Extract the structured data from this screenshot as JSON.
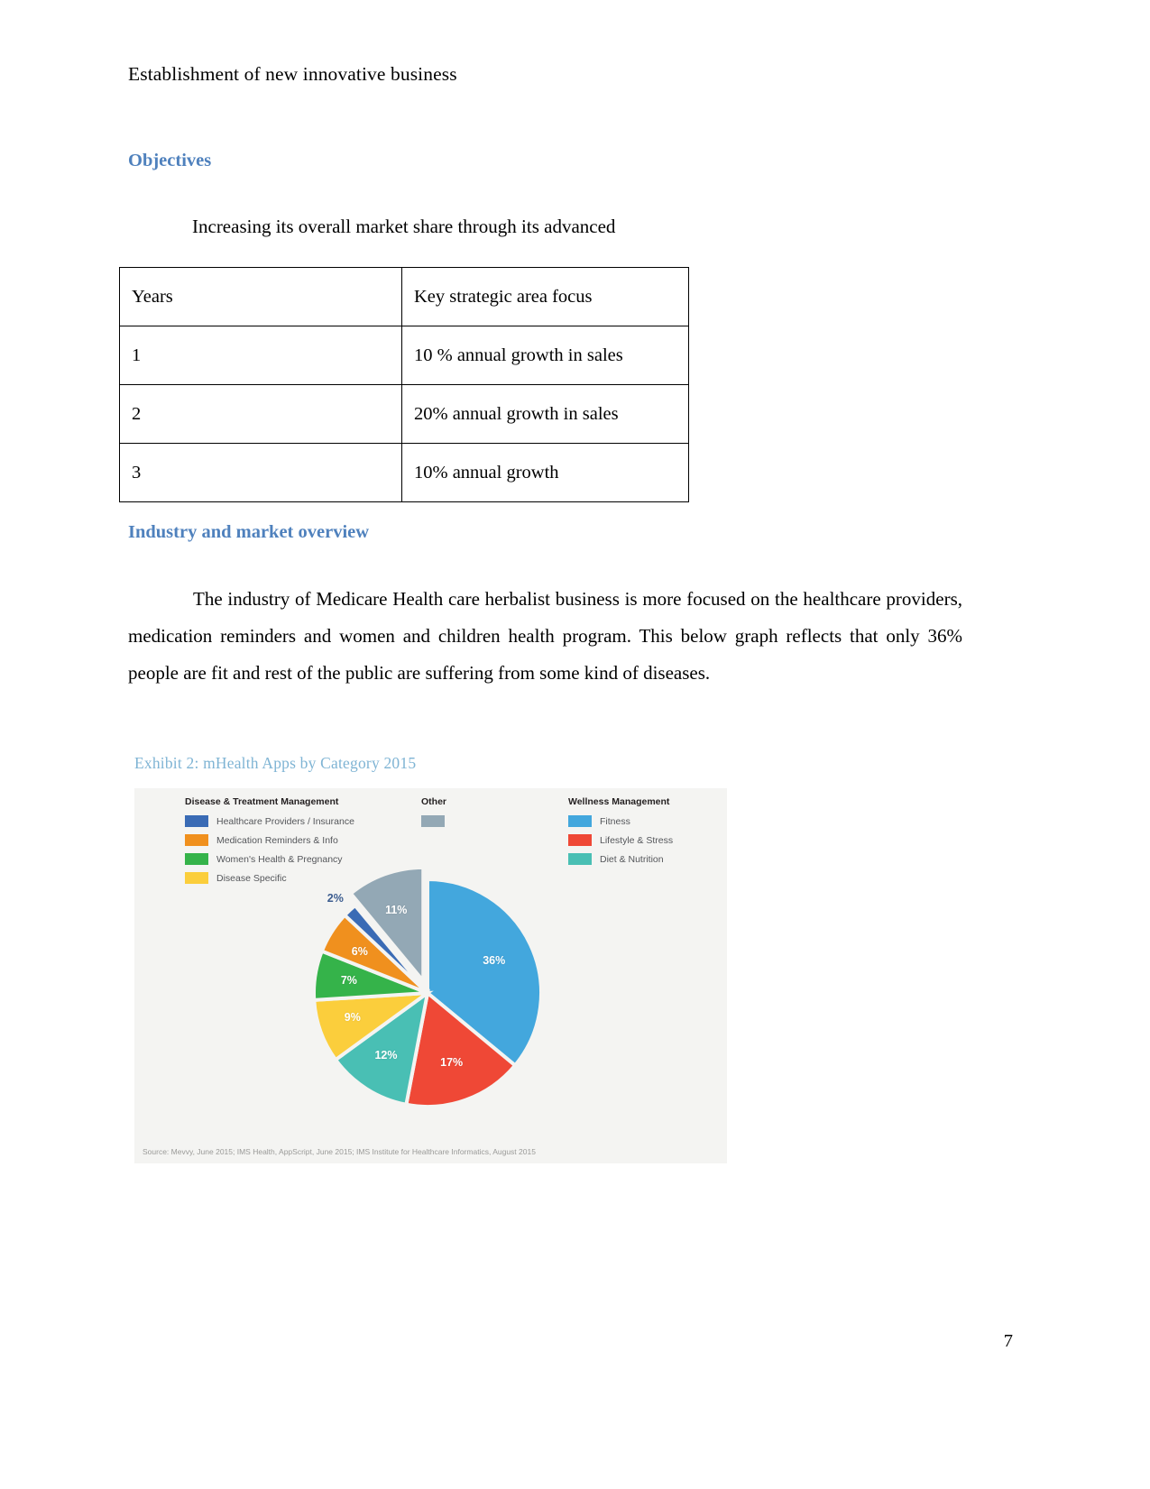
{
  "document": {
    "header": "Establishment of new innovative business",
    "page_number": "7",
    "sections": {
      "objectives_heading": "Objectives",
      "objectives_intro": "Increasing its overall market share through its advanced",
      "industry_heading": "Industry and market overview",
      "industry_para": "The industry of Medicare Health care herbalist business is more focused on the healthcare providers, medication reminders and women and children health program. This below graph reflects that only 36% people are fit and rest of the public are suffering from some kind of diseases."
    },
    "objectives_table": {
      "headers": [
        "Years",
        "Key strategic area focus"
      ],
      "rows": [
        [
          "1",
          "10 % annual growth in sales"
        ],
        [
          "2",
          "20% annual growth in sales"
        ],
        [
          "3",
          "10% annual growth"
        ]
      ]
    }
  },
  "colors": {
    "heading_blue": "#4f81bd",
    "exhibit_title_blue": "#7fb4d4",
    "chart_background": "#f4f4f2"
  },
  "chart_data": {
    "type": "pie",
    "title": "Exhibit 2: mHealth Apps by Category 2015",
    "source": "Source: Mevvy, June 2015; IMS Health, AppScript, June 2015; IMS Institute for Healthcare Informatics, August 2015",
    "legend_position": "top",
    "legend_groups": [
      {
        "heading": "Disease & Treatment Management",
        "items": [
          {
            "label": "Healthcare Providers / Insurance",
            "color": "#3a6bb5"
          },
          {
            "label": "Medication Reminders & Info",
            "color": "#f0901e"
          },
          {
            "label": "Women's Health & Pregnancy",
            "color": "#35b34a"
          },
          {
            "label": "Disease Specific",
            "color": "#fbce3c"
          }
        ]
      },
      {
        "heading": "Other",
        "items": [
          {
            "label": "",
            "color": "#93a8b5"
          }
        ]
      },
      {
        "heading": "Wellness Management",
        "items": [
          {
            "label": "Fitness",
            "color": "#43a7dd"
          },
          {
            "label": "Lifestyle & Stress",
            "color": "#ef4836"
          },
          {
            "label": "Diet & Nutrition",
            "color": "#49bfb4"
          }
        ]
      }
    ],
    "categories": [
      "Fitness",
      "Lifestyle & Stress",
      "Diet & Nutrition",
      "Disease Specific",
      "Women's Health & Pregnancy",
      "Medication Reminders & Info",
      "Healthcare Providers / Insurance",
      "Other"
    ],
    "values": [
      36,
      17,
      12,
      9,
      7,
      6,
      2,
      11
    ],
    "value_labels": [
      "36%",
      "17%",
      "12%",
      "9%",
      "7%",
      "6%",
      "2%",
      "11%"
    ],
    "slice_colors": [
      "#43a7dd",
      "#ef4836",
      "#49bfb4",
      "#fbce3c",
      "#35b34a",
      "#f0901e",
      "#3a6bb5",
      "#93a8b5"
    ],
    "exploded_slice": "Other"
  }
}
